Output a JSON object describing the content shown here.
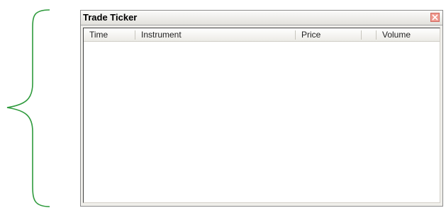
{
  "window": {
    "title": "Trade Ticker",
    "close_label": "close"
  },
  "grid": {
    "columns": [
      {
        "label": "Time"
      },
      {
        "label": "Instrument"
      },
      {
        "label": "Price"
      },
      {
        "label": "Volume"
      }
    ],
    "rows": []
  },
  "annotation": {
    "icon": "curly-brace-icon",
    "color": "#2e9a3c"
  },
  "colors": {
    "close_button": "#f09a90",
    "window_border": "#8c8c8c"
  }
}
